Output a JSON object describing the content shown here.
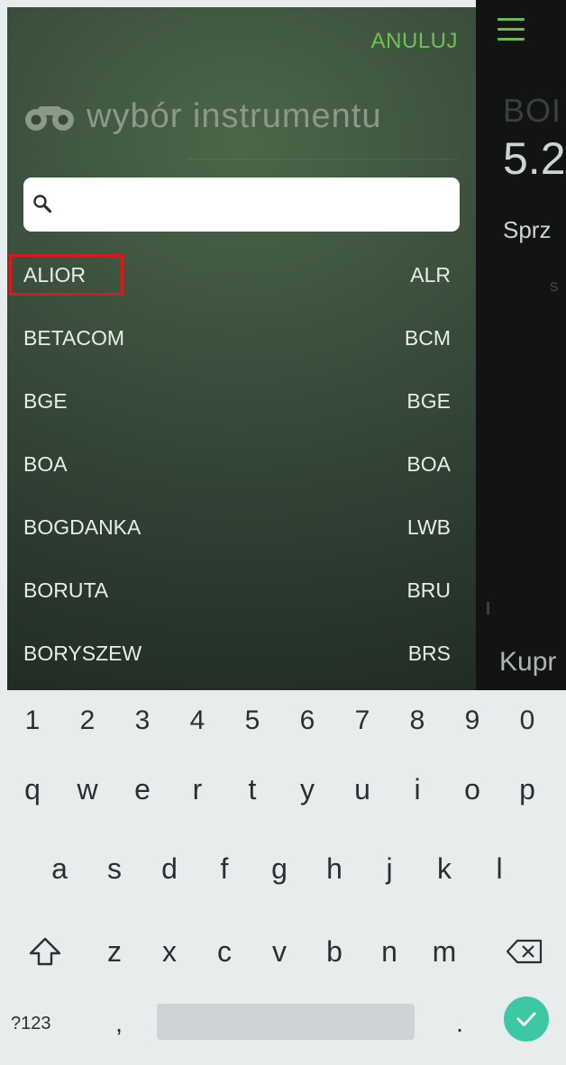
{
  "background_app": {
    "title_partial": "BOI",
    "price_partial": "5.2",
    "sell_partial": "Sprz",
    "small_partial": "S",
    "buy_partial": "Kupr",
    "accent_color": "#6dbb4e"
  },
  "drawer": {
    "cancel_label": "ANULUJ",
    "title": "wybór instrumentu",
    "title_icon": "binoculars-icon",
    "search": {
      "placeholder": "",
      "value": ""
    },
    "instruments": [
      {
        "name": "ALIOR",
        "code": "ALR",
        "highlighted": true
      },
      {
        "name": "BETACOM",
        "code": "BCM"
      },
      {
        "name": "BGE",
        "code": "BGE"
      },
      {
        "name": "BOA",
        "code": "BOA"
      },
      {
        "name": "BOGDANKA",
        "code": "LWB"
      },
      {
        "name": "BORUTA",
        "code": "BRU"
      },
      {
        "name": "BORYSZEW",
        "code": "BRS"
      }
    ],
    "highlight_color": "#e0161b"
  },
  "keyboard": {
    "numbers": [
      "1",
      "2",
      "3",
      "4",
      "5",
      "6",
      "7",
      "8",
      "9",
      "0"
    ],
    "row1": [
      "q",
      "w",
      "e",
      "r",
      "t",
      "y",
      "u",
      "i",
      "o",
      "p"
    ],
    "row2": [
      "a",
      "s",
      "d",
      "f",
      "g",
      "h",
      "j",
      "k",
      "l"
    ],
    "row3": [
      "z",
      "x",
      "c",
      "v",
      "b",
      "n",
      "m"
    ],
    "mode_label": "?123",
    "comma_label": ",",
    "period_label": ".",
    "shift_icon": "shift-icon",
    "backspace_icon": "backspace-icon",
    "done_icon": "checkmark-icon",
    "done_color": "#3cc8a5"
  }
}
